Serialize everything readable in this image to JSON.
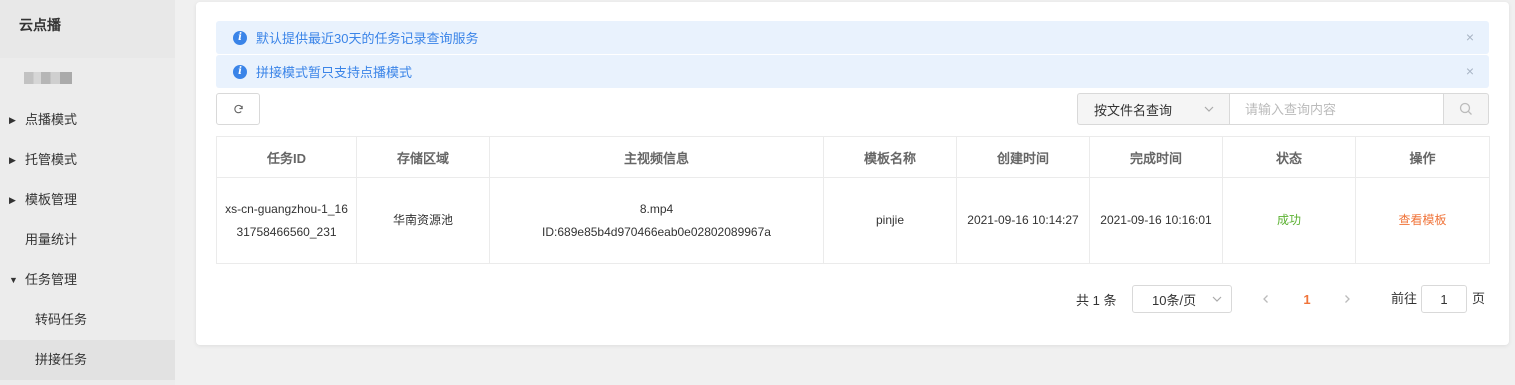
{
  "sidebar": {
    "title": "云点播",
    "items": [
      {
        "label": "点播模式",
        "arrow": "▶"
      },
      {
        "label": "托管模式",
        "arrow": "▶"
      },
      {
        "label": "模板管理",
        "arrow": "▶"
      },
      {
        "label": "用量统计"
      },
      {
        "label": "任务管理",
        "arrow": "▼"
      },
      {
        "label": "转码任务"
      },
      {
        "label": "拼接任务"
      }
    ]
  },
  "notices": [
    {
      "text": "默认提供最近30天的任务记录查询服务",
      "close": "×"
    },
    {
      "text": "拼接模式暂只支持点播模式",
      "close": "×"
    }
  ],
  "search": {
    "mode": "按文件名查询",
    "placeholder": "请输入查询内容"
  },
  "table": {
    "headers": [
      "任务ID",
      "存储区域",
      "主视频信息",
      "模板名称",
      "创建时间",
      "完成时间",
      "状态",
      "操作"
    ],
    "rows": [
      {
        "task_id": "xs-cn-guangzhou-1_1631758466560_231",
        "region": "华南资源池",
        "video_name": "8.mp4",
        "video_id": "ID:689e85b4d970466eab0e02802089967a",
        "template": "pinjie",
        "created": "2021-09-16 10:14:27",
        "finished": "2021-09-16 10:16:01",
        "status": "成功",
        "action": "查看模板"
      }
    ]
  },
  "pagination": {
    "total": "共 1 条",
    "page_size": "10条/页",
    "current_page": "1",
    "goto_prefix": "前往",
    "goto_value": "1",
    "goto_suffix": "页"
  },
  "colors": {
    "accent": "#3a84e8",
    "success": "#5bb131",
    "link": "#f0743a"
  }
}
